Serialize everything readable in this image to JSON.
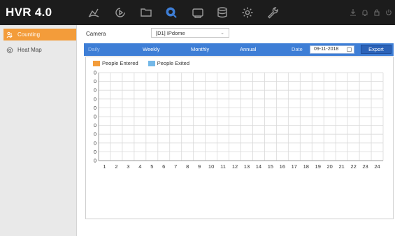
{
  "app": {
    "title": "HVR 4.0"
  },
  "top_nav": [
    {
      "name": "live-view-icon"
    },
    {
      "name": "playback-icon"
    },
    {
      "name": "file-management-icon"
    },
    {
      "name": "smart-analysis-icon",
      "active": true
    },
    {
      "name": "camera-icon"
    },
    {
      "name": "storage-icon"
    },
    {
      "name": "system-settings-icon"
    },
    {
      "name": "maintenance-icon"
    }
  ],
  "top_right": [
    "download-icon",
    "alarm-icon",
    "lock-icon",
    "power-icon"
  ],
  "sidebar": {
    "items": [
      {
        "label": "Counting",
        "icon": "people-counting-icon",
        "active": true
      },
      {
        "label": "Heat Map",
        "icon": "heat-map-icon",
        "active": false
      }
    ]
  },
  "camera": {
    "label": "Camera",
    "value": "[D1] IPdome"
  },
  "tabs": [
    {
      "label": "Daily",
      "selected": true
    },
    {
      "label": "Weekly",
      "selected": false
    },
    {
      "label": "Monthly",
      "selected": false
    },
    {
      "label": "Annual",
      "selected": false
    }
  ],
  "date": {
    "label": "Date",
    "value": "09-11-2018"
  },
  "export_label": "Export",
  "colors": {
    "accent": "#f39c3a",
    "tabbar": "#3e7ed6",
    "entered": "#f39c3a",
    "exited": "#74b8e8",
    "grid": "#d9d9d9"
  },
  "chart_data": {
    "type": "bar",
    "categories": [
      "1",
      "2",
      "3",
      "4",
      "5",
      "6",
      "7",
      "8",
      "9",
      "10",
      "11",
      "12",
      "13",
      "14",
      "15",
      "16",
      "17",
      "18",
      "19",
      "20",
      "21",
      "22",
      "23",
      "24"
    ],
    "series": [
      {
        "name": "People Entered",
        "values": [
          0,
          0,
          0,
          0,
          0,
          0,
          0,
          0,
          0,
          0,
          0,
          0,
          0,
          0,
          0,
          0,
          0,
          0,
          0,
          0,
          0,
          0,
          0,
          0
        ]
      },
      {
        "name": "People Exited",
        "values": [
          0,
          0,
          0,
          0,
          0,
          0,
          0,
          0,
          0,
          0,
          0,
          0,
          0,
          0,
          0,
          0,
          0,
          0,
          0,
          0,
          0,
          0,
          0,
          0
        ]
      }
    ],
    "y_ticks": [
      "0",
      "0",
      "0",
      "0",
      "0",
      "0",
      "0",
      "0",
      "0",
      "0",
      "0"
    ],
    "grid": true,
    "legend": "top-left"
  }
}
